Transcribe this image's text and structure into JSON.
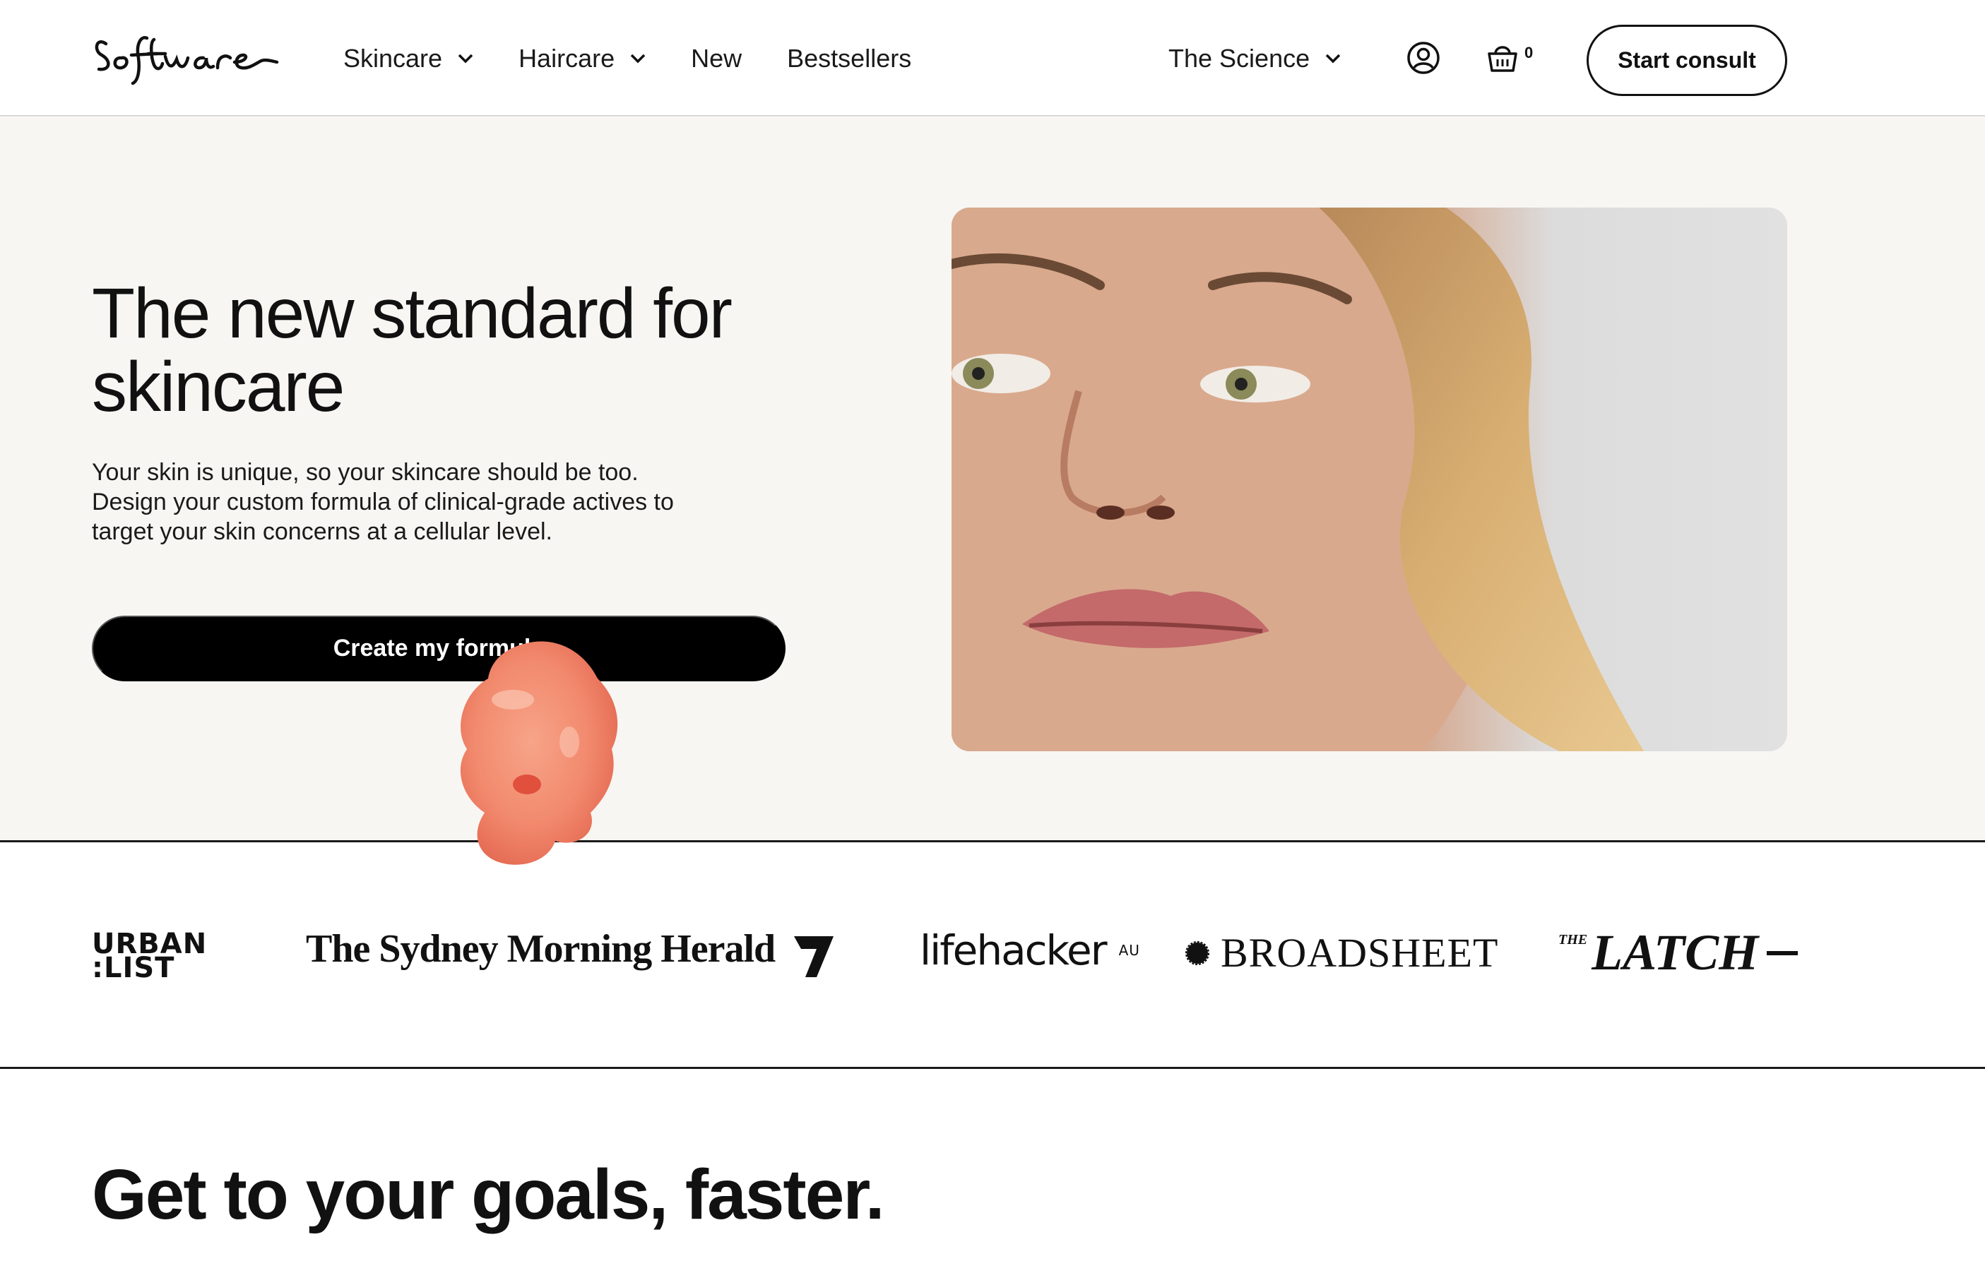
{
  "header": {
    "logo_text": "Software",
    "nav": [
      {
        "label": "Skincare",
        "has_dropdown": true
      },
      {
        "label": "Haircare",
        "has_dropdown": true
      },
      {
        "label": "New",
        "has_dropdown": false
      },
      {
        "label": "Bestsellers",
        "has_dropdown": false
      }
    ],
    "science_label": "The Science",
    "cart_count": "0",
    "consult_label": "Start consult"
  },
  "hero": {
    "title": "The new standard for skincare",
    "description": "Your skin is unique, so your skincare should be too. Design your custom formula of clinical-grade actives to target your skin concerns at a cellular level.",
    "cta_label": "Create my formula",
    "background_color": "#f7f6f3"
  },
  "press": {
    "logos": [
      {
        "name": "urban-list",
        "text": "URBAN\n:LIST"
      },
      {
        "name": "sydney-morning-herald",
        "text": "The Sydney Morning Herald"
      },
      {
        "name": "seven-network",
        "text": "7"
      },
      {
        "name": "lifehacker",
        "text": "lifehacker",
        "suffix": "AU"
      },
      {
        "name": "broadsheet",
        "text": "BROADSHEET"
      },
      {
        "name": "the-latch",
        "prefix": "THE",
        "text": "LATCH"
      }
    ]
  },
  "goals": {
    "heading": "Get to your goals, faster."
  },
  "colors": {
    "accent_blob": "#f28a6e",
    "button_dark": "#000000"
  }
}
